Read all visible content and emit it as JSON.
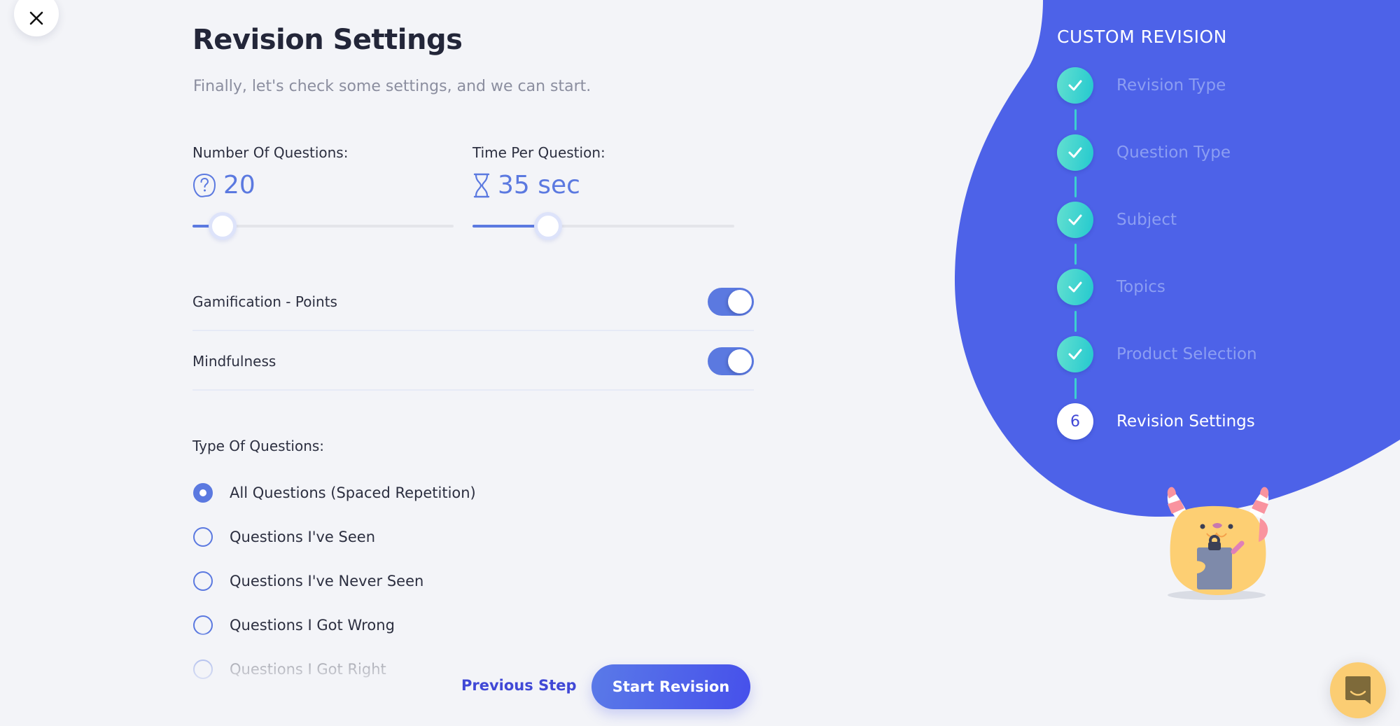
{
  "close": {
    "icon": "close-icon",
    "label": "Close"
  },
  "header": {
    "title": "Revision Settings",
    "subtitle": "Finally, let's check some settings, and we can start."
  },
  "settings": {
    "questions": {
      "label": "Number Of Questions:",
      "icon": "question-bubble-icon",
      "value": "20",
      "slider_fraction": 0.115
    },
    "time": {
      "label": "Time Per Question:",
      "icon": "hourglass-icon",
      "value": "35 sec",
      "slider_fraction": 0.29
    },
    "toggles": [
      {
        "label": "Gamification - Points",
        "on": true
      },
      {
        "label": "Mindfulness",
        "on": true
      }
    ],
    "type_label": "Type Of Questions:",
    "question_types": [
      {
        "label": "All Questions (Spaced Repetition)",
        "selected": true
      },
      {
        "label": "Questions I've Seen",
        "selected": false
      },
      {
        "label": "Questions I've Never Seen",
        "selected": false
      },
      {
        "label": "Questions I Got Wrong",
        "selected": false
      },
      {
        "label": "Questions I Got Right",
        "selected": false
      }
    ]
  },
  "actions": {
    "previous": "Previous Step",
    "start": "Start Revision"
  },
  "wizard": {
    "title": "CUSTOM REVISION",
    "steps": [
      {
        "label": "Revision Type",
        "status": "done"
      },
      {
        "label": "Question Type",
        "status": "done"
      },
      {
        "label": "Subject",
        "status": "done"
      },
      {
        "label": "Topics",
        "status": "done"
      },
      {
        "label": "Product Selection",
        "status": "done"
      },
      {
        "label": "Revision Settings",
        "status": "current",
        "number": "6"
      }
    ]
  },
  "colors": {
    "accent": "#5b79e0",
    "panel": "#4d62e8",
    "step_done": "#2ecdd0",
    "chat": "#fbcd73"
  },
  "chat": {
    "icon": "chat-icon"
  }
}
